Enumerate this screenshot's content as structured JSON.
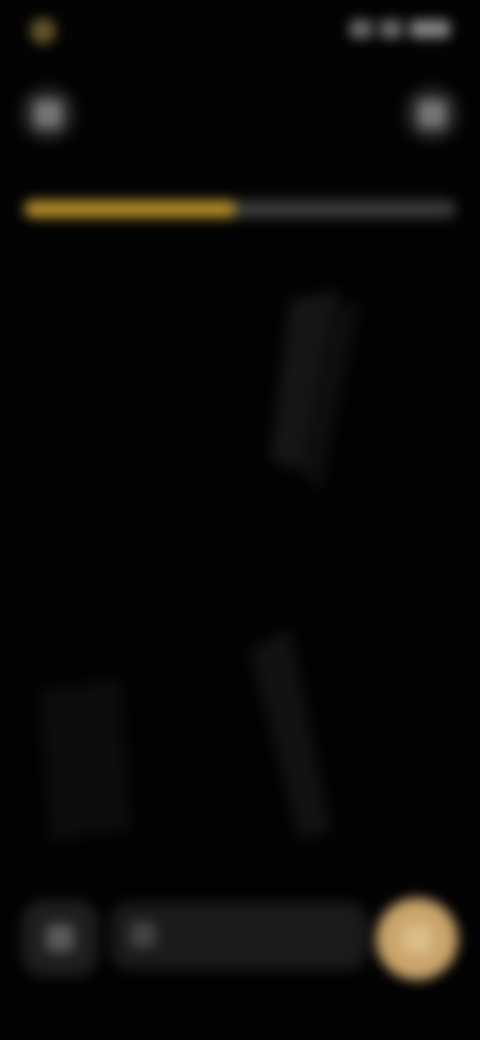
{
  "status_bar": {
    "time": "",
    "icons": [
      "signal-icon",
      "wifi-icon",
      "battery-icon"
    ]
  },
  "header": {
    "title": "",
    "left_icon": "back-icon",
    "right_icon": "menu-icon"
  },
  "progress": {
    "label": "",
    "count": "",
    "fraction": 0.49,
    "subtitle": ""
  },
  "content": {
    "statement": "",
    "link": ""
  },
  "bottom_bar": {
    "left_icon": "keyboard-icon",
    "input_placeholder": "",
    "input_icon": "mic-icon",
    "send_icon": "send-icon"
  },
  "colors": {
    "background": "#030303",
    "accent": "#b08a2a",
    "send_button": "#c9a46a"
  }
}
